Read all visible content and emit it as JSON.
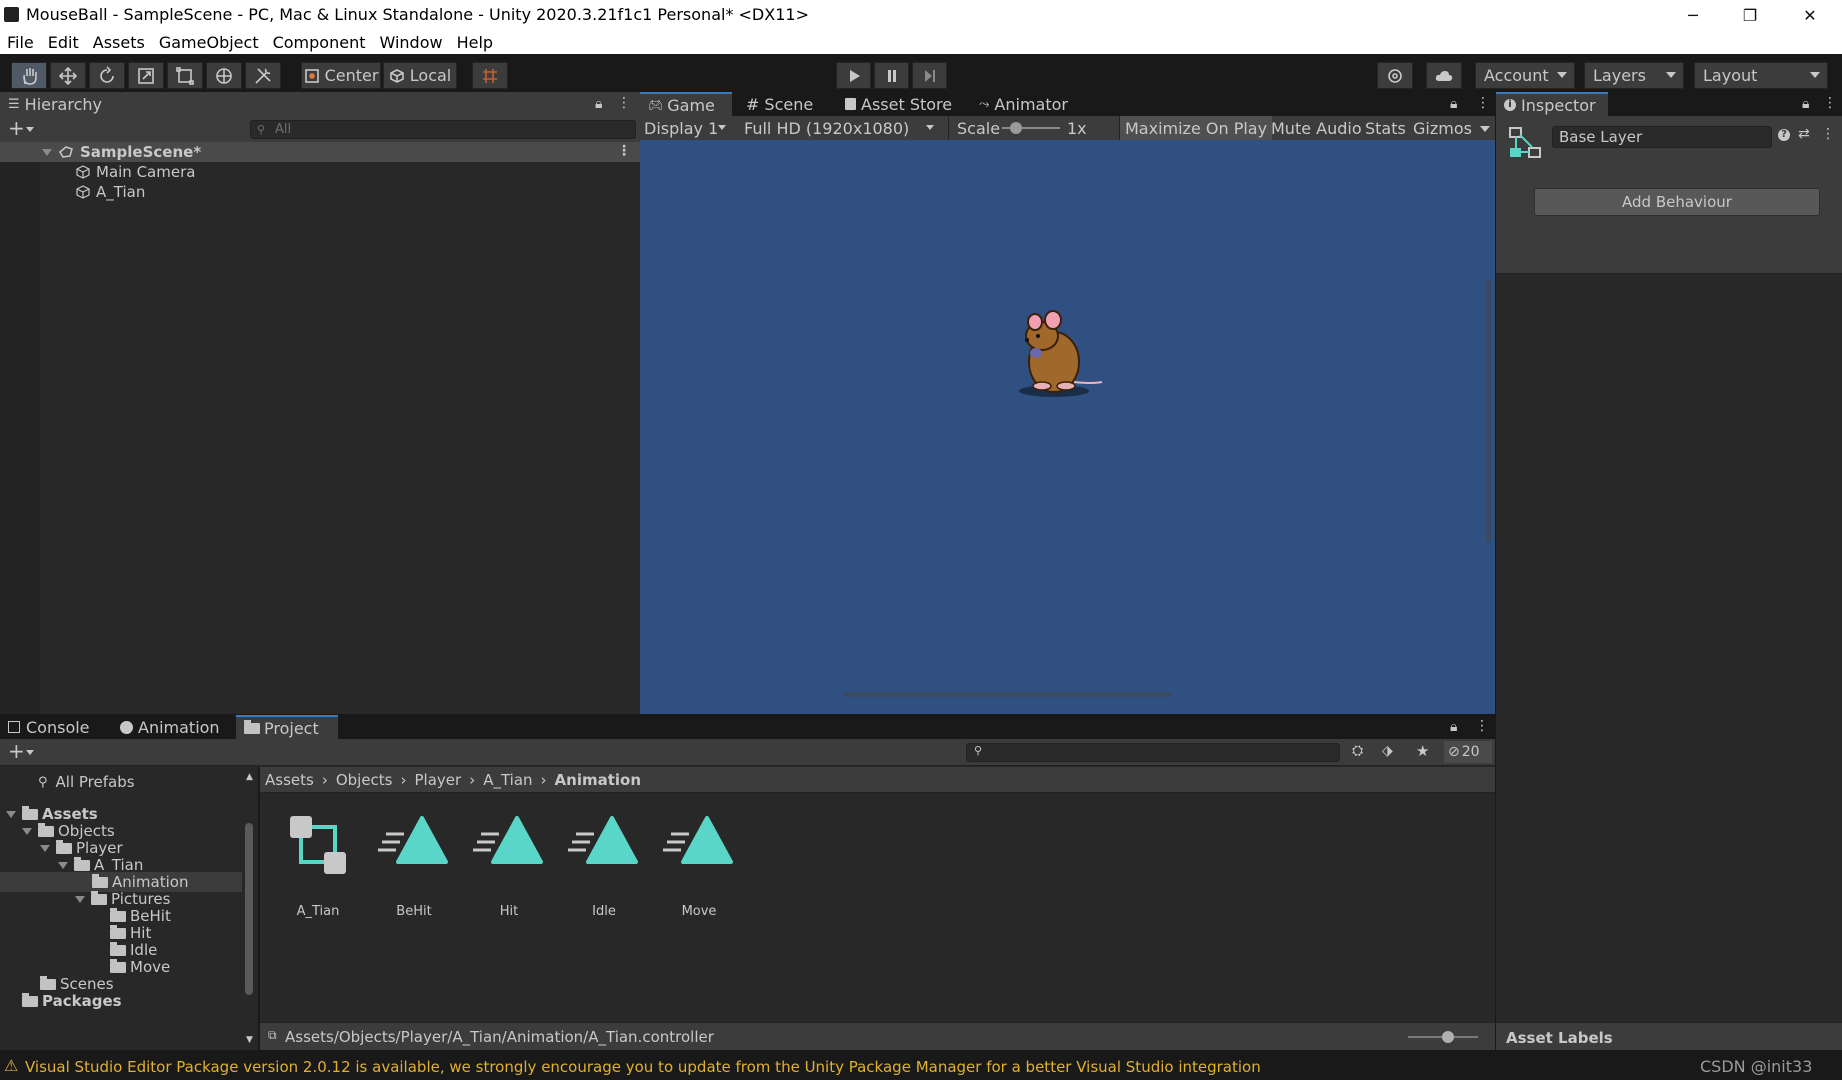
{
  "window": {
    "title": "MouseBall - SampleScene - PC, Mac & Linux Standalone - Unity 2020.3.21f1c1 Personal* <DX11>",
    "minimize": "─",
    "restore": "❐",
    "close": "✕"
  },
  "menu": [
    "File",
    "Edit",
    "Assets",
    "GameObject",
    "Component",
    "Window",
    "Help"
  ],
  "toolbar": {
    "pivot_label": "Center",
    "space_label": "Local",
    "account_label": "Account",
    "layers_label": "Layers",
    "layout_label": "Layout"
  },
  "hierarchy": {
    "tab": "Hierarchy",
    "search_placeholder": "All",
    "add": "+",
    "scene": "SampleScene*",
    "items": [
      "Main Camera",
      "A_Tian"
    ]
  },
  "game": {
    "tabs": [
      "Game",
      "Scene",
      "Asset Store",
      "Animator"
    ],
    "display": "Display 1",
    "resolution": "Full HD (1920x1080)",
    "scale_label": "Scale",
    "scale_value": "1x",
    "maximize": "Maximize On Play",
    "mute": "Mute Audio",
    "stats": "Stats",
    "gizmos": "Gizmos",
    "background_color": "#2f5080"
  },
  "inspector": {
    "tab": "Inspector",
    "layer_name": "Base Layer",
    "add_behaviour": "Add Behaviour",
    "asset_labels": "Asset Labels"
  },
  "bottom": {
    "tabs": [
      "Console",
      "Animation",
      "Project"
    ],
    "add": "+",
    "hidden_count": "20",
    "all_prefabs": "All Prefabs",
    "tree": {
      "assets": "Assets",
      "objects": "Objects",
      "player": "Player",
      "a_tian": "A_Tian",
      "animation": "Animation",
      "pictures": "Pictures",
      "behit": "BeHit",
      "hit": "Hit",
      "idle": "Idle",
      "move": "Move",
      "scenes": "Scenes",
      "packages": "Packages"
    },
    "breadcrumb": [
      "Assets",
      "Objects",
      "Player",
      "A_Tian",
      "Animation"
    ],
    "assets": [
      "A_Tian",
      "BeHit",
      "Hit",
      "Idle",
      "Move"
    ],
    "selected_path": "Assets/Objects/Player/A_Tian/Animation/A_Tian.controller"
  },
  "status": {
    "message": "Visual Studio Editor Package version 2.0.12 is available, we strongly encourage you to update from the Unity Package Manager for a better Visual Studio integration",
    "watermark": "CSDN @init33"
  }
}
